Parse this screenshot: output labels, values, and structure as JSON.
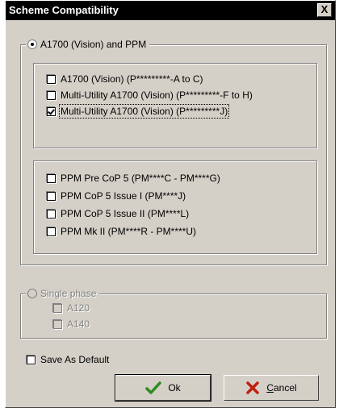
{
  "window": {
    "title": "Scheme Compatibility",
    "close_glyph": "X"
  },
  "group_a1700": {
    "label": "A1700 (Vision) and PPM",
    "selected": true,
    "vision_options": [
      {
        "label": "A1700 (Vision) (P*********-A to C)",
        "checked": false
      },
      {
        "label": "Multi-Utility A1700 (Vision) (P*********-F to H)",
        "checked": false
      },
      {
        "label": "Multi-Utility A1700 (Vision) (P*********J)",
        "checked": true
      }
    ],
    "ppm_options": [
      {
        "label": "PPM Pre CoP 5 (PM****C - PM****G)",
        "checked": false
      },
      {
        "label": "PPM CoP 5 Issue I (PM****J)",
        "checked": false
      },
      {
        "label": "PPM CoP 5 Issue II (PM****L)",
        "checked": false
      },
      {
        "label": "PPM Mk II (PM****R - PM****U)",
        "checked": false
      }
    ]
  },
  "group_single": {
    "label": "Single phase",
    "selected": false,
    "options": [
      {
        "label": "A120",
        "checked": false
      },
      {
        "label": "A140",
        "checked": false
      }
    ]
  },
  "save_default": {
    "label": "Save As Default",
    "checked": false
  },
  "buttons": {
    "ok": {
      "label": "Ok",
      "icon": "checkmark-icon",
      "color": "#2e8b1e"
    },
    "cancel": {
      "label_accel": "C",
      "label_rest": "ancel",
      "icon": "x-mark-icon",
      "color": "#c0200f"
    }
  }
}
